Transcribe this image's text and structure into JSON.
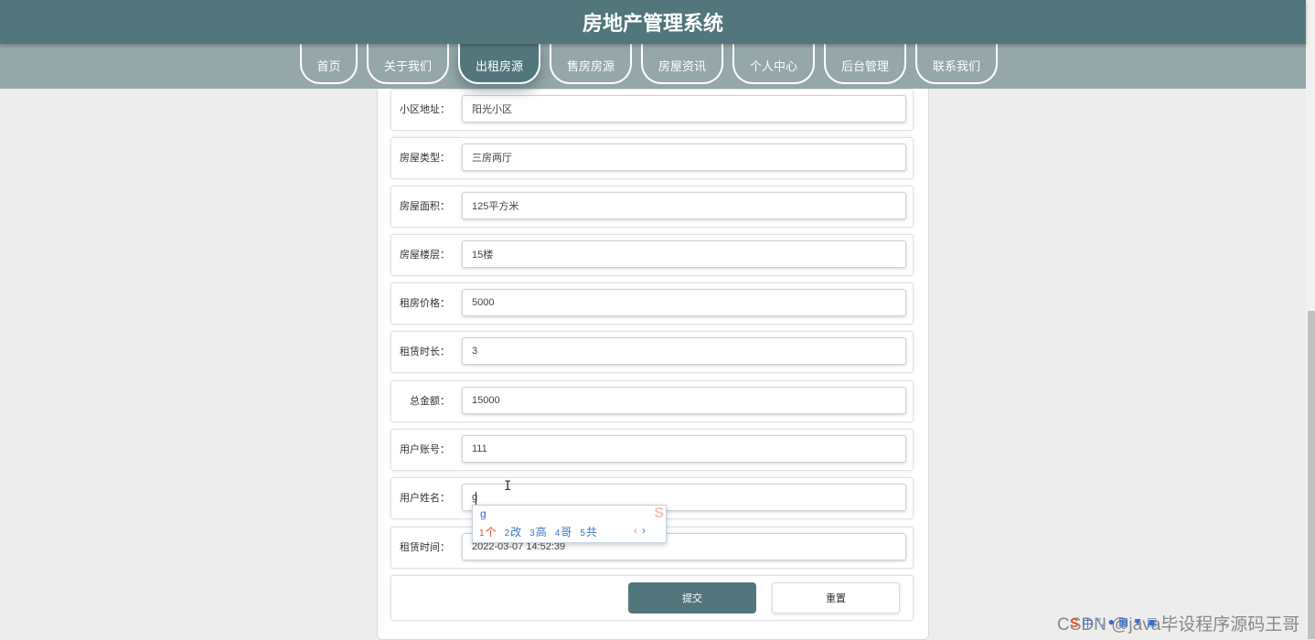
{
  "header": {
    "title": "房地产管理系统"
  },
  "nav": {
    "items": [
      {
        "label": "首页",
        "active": false
      },
      {
        "label": "关于我们",
        "active": false
      },
      {
        "label": "出租房源",
        "active": true
      },
      {
        "label": "售房房源",
        "active": false
      },
      {
        "label": "房屋资讯",
        "active": false
      },
      {
        "label": "个人中心",
        "active": false
      },
      {
        "label": "后台管理",
        "active": false
      },
      {
        "label": "联系我们",
        "active": false
      }
    ]
  },
  "form": {
    "fields": [
      {
        "label": "小区地址：",
        "value": "阳光小区"
      },
      {
        "label": "房屋类型：",
        "value": "三房两厅"
      },
      {
        "label": "房屋面积：",
        "value": "125平方米"
      },
      {
        "label": "房屋楼层：",
        "value": "15楼"
      },
      {
        "label": "租房价格：",
        "value": "5000"
      },
      {
        "label": "租赁时长：",
        "value": "3"
      },
      {
        "label": "总金额：",
        "value": "15000"
      },
      {
        "label": "用户账号：",
        "value": "111"
      },
      {
        "label": "用户姓名：",
        "value": "g"
      },
      {
        "label": "租赁时间：",
        "value": "2022-03-07 14:52:39"
      }
    ],
    "submit_label": "提交",
    "reset_label": "重置"
  },
  "ime": {
    "composition": "g",
    "candidates": [
      {
        "num": "1",
        "text": "个"
      },
      {
        "num": "2",
        "text": "改"
      },
      {
        "num": "3",
        "text": "高"
      },
      {
        "num": "4",
        "text": "哥"
      },
      {
        "num": "5",
        "text": "共"
      }
    ],
    "prev_symbol": "‹",
    "next_symbol": "›",
    "tray": {
      "mode": "中",
      "logo": "S"
    }
  },
  "watermark": "CSDN @java毕设程序源码王哥",
  "colors": {
    "primary": "#52767c",
    "nav_bg": "#95a7a9",
    "page_bg": "#ededee"
  }
}
